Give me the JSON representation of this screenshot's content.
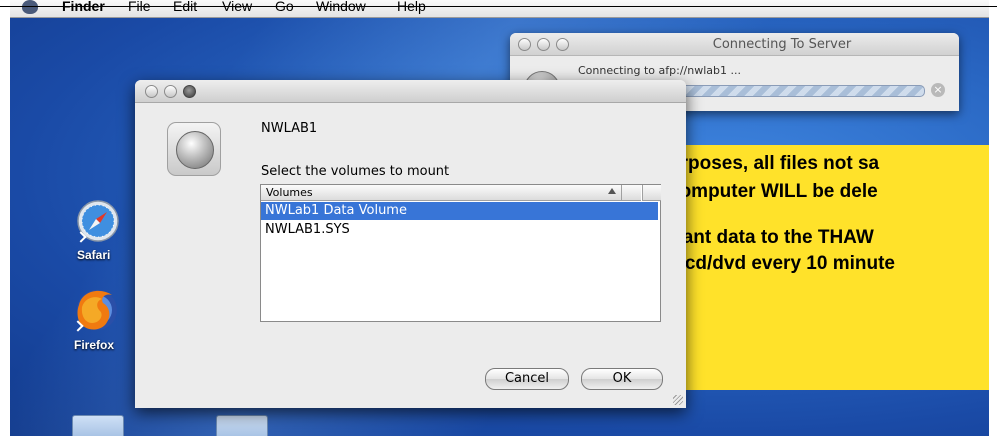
{
  "menubar": {
    "items": [
      "Finder",
      "File",
      "Edit",
      "View",
      "Go",
      "Window",
      "Help"
    ]
  },
  "desktop": {
    "icons": [
      {
        "label": "Safari",
        "icon": "safari-icon"
      },
      {
        "label": "Firefox",
        "icon": "firefox-icon"
      }
    ],
    "notice_lines": [
      "urposes, all files not sa",
      "computer WILL be dele",
      "rtant data to the THAW",
      "e/cd/dvd every 10 minute"
    ]
  },
  "connecting_window": {
    "title": "Connecting To Server",
    "message": "Connecting to afp://nwlab1 ..."
  },
  "dialog": {
    "server_name": "NWLAB1",
    "prompt": "Select the volumes to mount",
    "column_header": "Volumes",
    "volumes": [
      {
        "name": "NWLab1 Data Volume",
        "selected": true
      },
      {
        "name": "NWLAB1.SYS",
        "selected": false
      }
    ],
    "cancel_label": "Cancel",
    "ok_label": "OK"
  },
  "colors": {
    "selection": "#3875d7",
    "notice_bg": "#ffe22a",
    "desktop_blue": "#2a68c4"
  }
}
